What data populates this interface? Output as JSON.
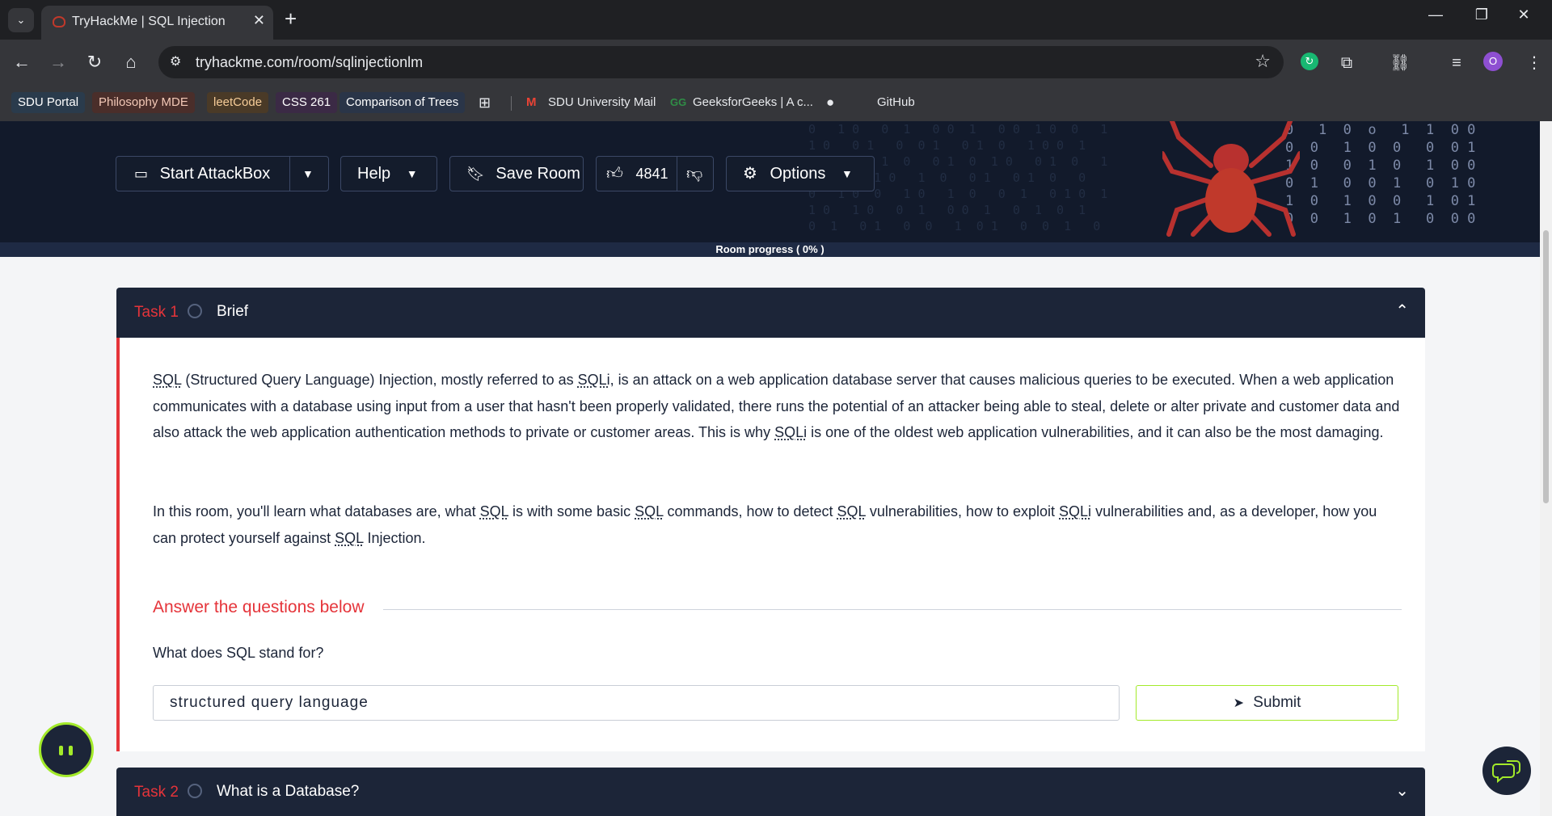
{
  "browser": {
    "tab_title": "TryHackMe | SQL Injection",
    "url": "tryhackme.com/room/sqlinjectionlm",
    "bookmarks": [
      {
        "label": "SDU Portal",
        "bg": "#2a3b4c",
        "fg": "#ffffff"
      },
      {
        "label": "Philosophy MDE",
        "bg": "#4a2e2a",
        "fg": "#f3c8b6"
      },
      {
        "label": "leetCode",
        "bg": "#4a3a27",
        "fg": "#f6cc98"
      },
      {
        "label": "CSS 261",
        "bg": "#3b2a45",
        "fg": "#ffffff"
      },
      {
        "label": "Comparison of Trees",
        "bg": "#2a3548",
        "fg": "#ffffff"
      }
    ],
    "bookmarks_plain": [
      {
        "label": "SDU University Mail",
        "icon": "gmail-icon"
      },
      {
        "label": "GeeksforGeeks | A c...",
        "icon": "gfg-icon"
      },
      {
        "label": "GitHub",
        "icon": "github-icon"
      }
    ],
    "avatar_letter": "O"
  },
  "room_toolbar": {
    "attackbox_label": "Start AttackBox",
    "help_label": "Help",
    "save_label": "Save Room",
    "likes_count": "4841",
    "options_label": "Options"
  },
  "progress": {
    "label": "Room progress ( 0% )",
    "value_percent": 0
  },
  "tasks": [
    {
      "number": "Task 1",
      "title": "Brief",
      "expanded": true,
      "paragraphs": [
        [
          {
            "t": "SQL",
            "abbr": true
          },
          {
            "t": " (Structured Query Language) Injection, mostly referred to as "
          },
          {
            "t": "SQLi",
            "abbr": true
          },
          {
            "t": ", is an attack on a web application database server that causes malicious queries to be executed. When a web application communicates with a database using input from a user that hasn't been properly validated, there runs the potential of an attacker being able to steal, delete or alter private and customer data and also attack the web application authentication methods to private or customer areas. This is why "
          },
          {
            "t": "SQLi",
            "abbr": true
          },
          {
            "t": " is one of the oldest web application vulnerabilities, and it can also be the most damaging."
          }
        ],
        [
          {
            "t": "In this room, you'll learn what databases are, what "
          },
          {
            "t": "SQL",
            "abbr": true
          },
          {
            "t": " is with some basic "
          },
          {
            "t": "SQL",
            "abbr": true
          },
          {
            "t": " commands, how to detect "
          },
          {
            "t": "SQL",
            "abbr": true
          },
          {
            "t": " vulnerabilities, how to exploit "
          },
          {
            "t": "SQLi",
            "abbr": true
          },
          {
            "t": " vulnerabilities and, as a developer, how you can protect yourself against "
          },
          {
            "t": "SQL",
            "abbr": true
          },
          {
            "t": " Injection."
          }
        ]
      ],
      "questions_heading": "Answer the questions below",
      "question": "What does SQL stand for?",
      "answer_value": "structured query language",
      "submit_label": "Submit"
    },
    {
      "number": "Task 2",
      "title": "What is a Database?",
      "expanded": false
    }
  ],
  "colors": {
    "accent_red": "#e5343a",
    "accent_green": "#a3ea2a",
    "navy": "#1c2538"
  }
}
